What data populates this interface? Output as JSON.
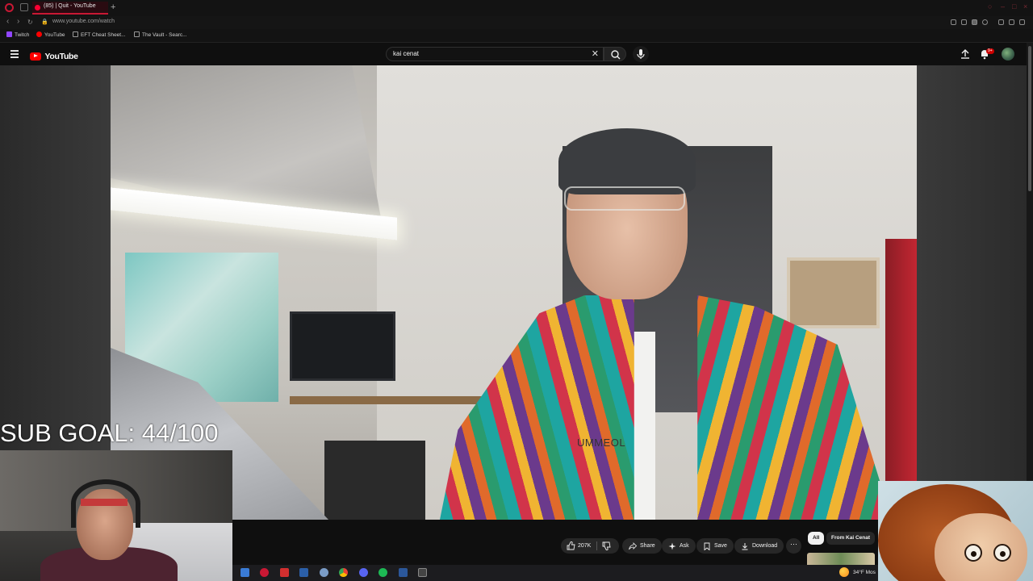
{
  "browser": {
    "tab_title": "(85) | Quit - YouTube",
    "new_tab": "+",
    "url": "www.youtube.com/watch",
    "bookmarks": [
      {
        "label": "Twitch",
        "color": "#9146ff"
      },
      {
        "label": "YouTube",
        "color": "#ff0000"
      },
      {
        "label": "EFT Cheat Sheet...",
        "color": "#888888"
      },
      {
        "label": "The Vault - Searc...",
        "color": "#888888"
      }
    ]
  },
  "youtube": {
    "logo_text": "YouTube",
    "search_query": "kai cenat",
    "notification_count": "9+",
    "accent": "#ff0000"
  },
  "video": {
    "shirt_text": "UMMEOL"
  },
  "overlay": {
    "sub_goal": "SUB GOAL: 44/100"
  },
  "actions": {
    "like_count": "207K",
    "share": "Share",
    "ask": "Ask",
    "save": "Save",
    "download": "Download",
    "more": "···"
  },
  "chips": {
    "all": "All",
    "from_channel": "From Kai Cenat"
  },
  "taskbar": {
    "weather": "34°F  Mos"
  }
}
